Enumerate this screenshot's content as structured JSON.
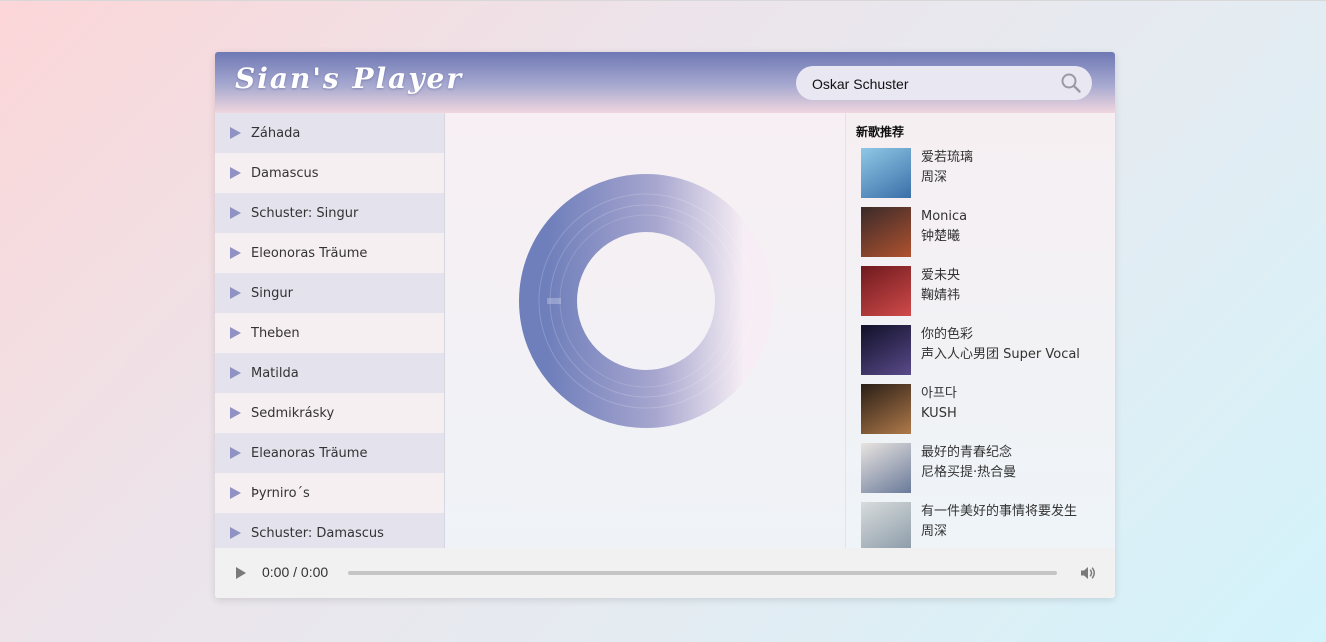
{
  "app": {
    "title": "Sian's Player"
  },
  "search": {
    "value": "Oskar Schuster",
    "icon": "search-icon"
  },
  "playlist": [
    {
      "title": "Záhada"
    },
    {
      "title": "Damascus"
    },
    {
      "title": "Schuster: Singur"
    },
    {
      "title": "Eleonoras Träume"
    },
    {
      "title": "Singur"
    },
    {
      "title": "Theben"
    },
    {
      "title": "Matilda"
    },
    {
      "title": "Sedmikrásky"
    },
    {
      "title": "Eleanoras Träume"
    },
    {
      "title": "Þyrniro´s"
    },
    {
      "title": "Schuster: Damascus"
    }
  ],
  "recommend": {
    "heading": "新歌推荐",
    "items": [
      {
        "song": "爱若琉璃",
        "artist": "周深",
        "cover": [
          "#8fc8e6",
          "#3a6fa8"
        ]
      },
      {
        "song": "Monica",
        "artist": "钟楚曦",
        "cover": [
          "#3a2a2a",
          "#b0522e"
        ]
      },
      {
        "song": "爱未央",
        "artist": "鞠婧祎",
        "cover": [
          "#6e1a1e",
          "#d04a4a"
        ]
      },
      {
        "song": "你的色彩",
        "artist": "声入人心男团 Super Vocal",
        "cover": [
          "#101028",
          "#5a4a8a"
        ]
      },
      {
        "song": "아프다",
        "artist": "KUSH",
        "cover": [
          "#2a1e16",
          "#b07a4a"
        ]
      },
      {
        "song": "最好的青春纪念",
        "artist": "尼格买提·热合曼",
        "cover": [
          "#e8e4e0",
          "#6a7a9a"
        ]
      },
      {
        "song": "有一件美好的事情将要发生",
        "artist": "周深",
        "cover": [
          "#d8dcdc",
          "#8a9aa8"
        ]
      }
    ]
  },
  "player": {
    "time": "0:00 / 0:00",
    "progress": 0
  },
  "colors": {
    "header_top": "#6e78b4",
    "header_bottom": "#f0d6de",
    "accent": "#8f92c2",
    "disc_left": "#6f7fbb",
    "disc_right": "#f6eef4"
  }
}
